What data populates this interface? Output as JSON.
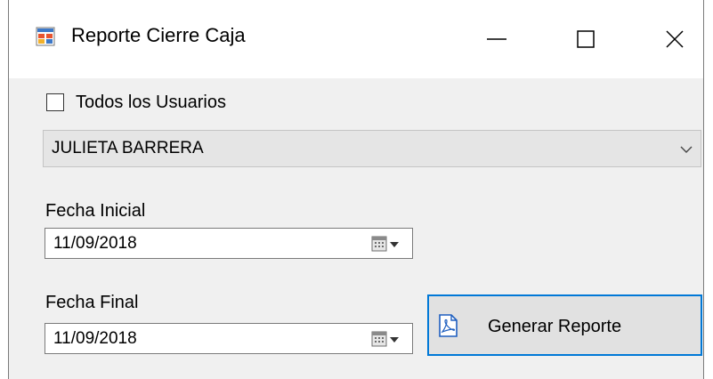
{
  "window": {
    "title": "Reporte Cierre Caja",
    "icon": "app-form-icon",
    "controls": {
      "minimize_icon": "minimize-icon",
      "maximize_icon": "maximize-icon",
      "close_icon": "close-icon"
    }
  },
  "filters": {
    "all_users_label": "Todos los Usuarios",
    "all_users_checked": false,
    "selected_user": "JULIETA BARRERA"
  },
  "dates": {
    "start_label": "Fecha Inicial",
    "start_value": "11/09/2018",
    "end_label": "Fecha Final",
    "end_value": "11/09/2018"
  },
  "actions": {
    "generate_label": "Generar Reporte",
    "generate_icon": "pdf-icon",
    "accent_color": "#0078d7"
  }
}
